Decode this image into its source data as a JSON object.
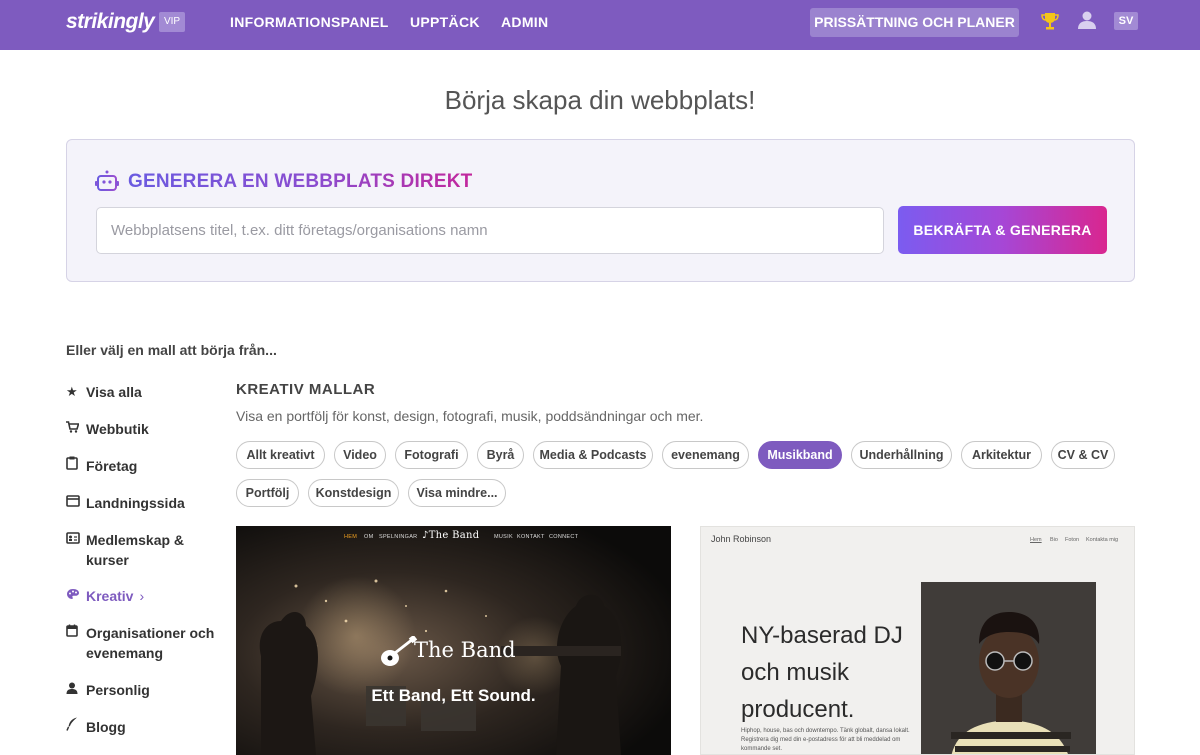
{
  "nav": {
    "logo": "strikingly",
    "vip": "VIP",
    "links": [
      "INFORMATIONSPANEL",
      "UPPTÄCK",
      "ADMIN"
    ],
    "pricing": "PRISSÄTTNING OCH PLANER",
    "lang": "SV",
    "bg_color": "#7e5bbf"
  },
  "page_title": "Börja skapa din webbplats!",
  "generate": {
    "title": "GENERERA EN WEBBPLATS DIREKT",
    "placeholder": "Webbplatsens titel, t.ex. ditt företags/organisations namn",
    "value": "",
    "button": "BEKRÄFTA & GENERERA",
    "icon": "robot-icon"
  },
  "choose_heading": "Eller välj en mall att börja från...",
  "sidebar": {
    "items": [
      {
        "icon": "star-icon",
        "label": "Visa alla"
      },
      {
        "icon": "cart-icon",
        "label": "Webbutik"
      },
      {
        "icon": "clipboard-icon",
        "label": "Företag"
      },
      {
        "icon": "window-icon",
        "label": "Landningssida"
      },
      {
        "icon": "id-card-icon",
        "label": "Medlemskap & kurser"
      },
      {
        "icon": "palette-icon",
        "label": "Kreativ",
        "active": true
      },
      {
        "icon": "calendar-icon",
        "label": "Organisationer och evenemang"
      },
      {
        "icon": "person-icon",
        "label": "Personlig"
      },
      {
        "icon": "quill-icon",
        "label": "Blogg"
      }
    ]
  },
  "section": {
    "title": "KREATIV MALLAR",
    "description": "Visa en portfölj för konst, design, fotografi, musik, poddsändningar och mer."
  },
  "chips": [
    {
      "label": "Allt kreativt"
    },
    {
      "label": "Video"
    },
    {
      "label": "Fotografi"
    },
    {
      "label": "Byrå"
    },
    {
      "label": "Media & Podcasts"
    },
    {
      "label": "evenemang"
    },
    {
      "label": "Musikband",
      "active": true
    },
    {
      "label": "Underhållning"
    },
    {
      "label": "Arkitektur"
    },
    {
      "label": "CV & CV"
    },
    {
      "label": "Portfölj"
    },
    {
      "label": "Konstdesign"
    },
    {
      "label": "Visa mindre..."
    }
  ],
  "templates": {
    "band": {
      "nav": [
        "HEM",
        "OM",
        "SPELNINGAR",
        "MUSIK",
        "KONTAKT",
        "CONNECT"
      ],
      "logo": "The Band",
      "headline": "The Band",
      "tagline": "Ett Band, Ett Sound."
    },
    "dj": {
      "name": "John Robinson",
      "nav": [
        "Hem",
        "Bio",
        "Foton",
        "Kontakta mig"
      ],
      "headline_lines": [
        "NY-baserad DJ",
        "och musik",
        "producent."
      ],
      "body": "Hiphop, house, bas och downtempo. Tänk globalt, dansa lokalt. Registrera dig med din e-postadress för att bli meddelad om kommande set."
    }
  }
}
